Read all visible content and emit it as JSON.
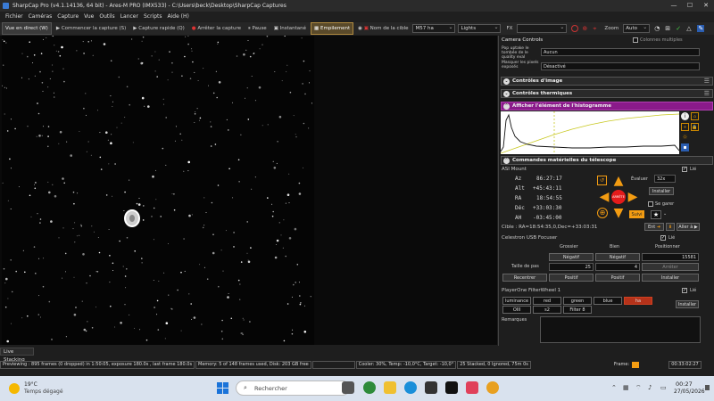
{
  "window": {
    "title": "SharpCap Pro (v4.1.14136, 64 bit) - Ares-M PRO (IMX533) - C:\\Users\\beck\\Desktop\\SharpCap Captures",
    "controls": [
      "—",
      "☐",
      "✕"
    ]
  },
  "menu": [
    "Fichier",
    "Caméras",
    "Capture",
    "Vue",
    "Outils",
    "Lancer",
    "Scripts",
    "Aide (H)"
  ],
  "toolbar": {
    "live": "Vue en direct (W)",
    "start_capture": "Commencer la capture (S)",
    "quick_capture": "Capture rapide (Q)",
    "stop_capture": "Arrêter la capture",
    "pause": "Pause",
    "snapshot": "Instantané",
    "stacking": "Empilement",
    "target_label": "Nom de la cible",
    "target_value": "M57 ha",
    "frame_type": "Lights",
    "fx_label": "FX",
    "zoom_label": "Zoom",
    "zoom_value": "Auto"
  },
  "panel": {
    "camera_controls": {
      "title": "Camera Controls",
      "multi_cols": "Colonnes multiples",
      "row1_label": "Pop uptake le tombée de le quality eval",
      "row1_value": "Aucun",
      "row2_label": "Masquer les pixels exposés",
      "row2_value": "Désactivé"
    },
    "image_controls": "Contrôles d'image",
    "thermal_controls": "Contrôles thermiques",
    "histogram_title": "Afficher l'élément de l'histogramme",
    "telescope": {
      "title": "Commandes matérielles du télescope",
      "mount_name": "ASI Mount",
      "linked": "Lié",
      "coords": [
        {
          "label": "Az",
          "value": "86:27:17"
        },
        {
          "label": "Alt",
          "value": "+45:43:11"
        },
        {
          "label": "RA",
          "value": "18:54:55"
        },
        {
          "label": "Déc",
          "value": "+33:03:30"
        },
        {
          "label": "AH",
          "value": "-03:45:00"
        }
      ],
      "rate_label": "Évaluer",
      "rate_value": "32x",
      "install": "Installer",
      "park": "Se garer",
      "stop": "ARRÊTE",
      "follow": "Suivi",
      "target_line": "Cible : RA=18:54:35,0,Dec=+33:03:31",
      "set_btn": "Ent",
      "goto_btn": "Aller à"
    },
    "focuser": {
      "title": "Celestron USB Focuser",
      "linked": "Lié",
      "coarse": "Grossier",
      "fine": "Bien",
      "position": "Positionner",
      "neg1": "Négatif",
      "neg2": "Négatif",
      "pos_value": "15581",
      "step_label": "Taille de pas",
      "step1": "25",
      "step2": "4",
      "stop": "Arrêter",
      "back": "Recentrer",
      "posbtn1": "Positif",
      "posbtn2": "Positif",
      "install": "Installer"
    },
    "filterwheel": {
      "title": "PlayerOne FilterWheel 1",
      "linked": "Lié",
      "filters": [
        "luminance",
        "red",
        "green",
        "blue",
        "ha",
        "OIII",
        "s2",
        "Filter 8"
      ],
      "active": "ha",
      "install": "Installer"
    },
    "remarks": "Remarques"
  },
  "live_stacking_tab": "Live Stacking",
  "status": {
    "preview": "Previewing : 895 frames (0 dropped) in 1:50:05, exposure 180.0s , last frame 180.0s",
    "memory": "Memory: 5 of 148 frames used, Disk: 203 GB free",
    "cooler": "Cooler: 30%, Temp: -10,0°C, Target: -10,0°",
    "stacked": "25 Stacked, 0 Ignored, 75m 0s",
    "frame_label": "Frame:",
    "elapsed": "00:33:02:27"
  },
  "taskbar": {
    "weather_temp": "19°C",
    "weather_desc": "Temps dégagé",
    "search_placeholder": "Rechercher",
    "time": "00:27",
    "date": "27/05/2026"
  },
  "colors": {
    "histogram_header": "#8a1a8a",
    "section_header": "#2a2a2a",
    "arrow_orange": "#f39c12",
    "stop_red": "#e31b1b",
    "active_filter": "#b5321a"
  }
}
